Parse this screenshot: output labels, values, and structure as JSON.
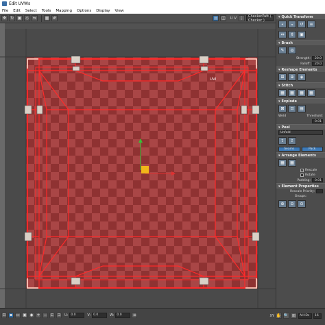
{
  "window": {
    "title": "Edit UVWs"
  },
  "menu": [
    "File",
    "Edit",
    "Select",
    "Tools",
    "Mapping",
    "Options",
    "Display",
    "View"
  ],
  "toolbar": {
    "uv_label": "U V",
    "checker_select": "CheckerPatt ( Checker )"
  },
  "viewport": {
    "uv_label": "UVl"
  },
  "panel": {
    "quick_transform": "Quick Transform",
    "brush": "Brush",
    "strength_label": "Strength:",
    "strength_value": "20.0",
    "falloff_label": "Falloff:",
    "falloff_value": "20.0",
    "reshape": "Reshape Elements",
    "stitch": "Stitch",
    "explode": "Explode",
    "weld_label": "Weld",
    "threshold_label": "Threshold:",
    "threshold_value": "0.01",
    "peel": "Peel",
    "peel_mode": "Unfold",
    "seams_btn": "Seams",
    "pack_btn": "Pack",
    "arrange": "Arrange Elements",
    "rescale": "Rescale",
    "rotate": "Rotate",
    "padding_label": "Padding:",
    "padding_value": "0.01",
    "elem_props": "Element Properties",
    "rescale_priority_label": "Rescale Priority:",
    "groups_label": "Groups:"
  },
  "status": {
    "u_value": "0.0",
    "v_value": "0.0",
    "w_value": "0.0",
    "xy_label": "XY",
    "all_ids": "All IDs",
    "zoom_value": "16"
  },
  "colors": {
    "checker_dark": "#8f3232",
    "checker_light": "#a94646",
    "uv_edge": "#ff2a2a",
    "selection_blue": "#2b6aa5"
  }
}
